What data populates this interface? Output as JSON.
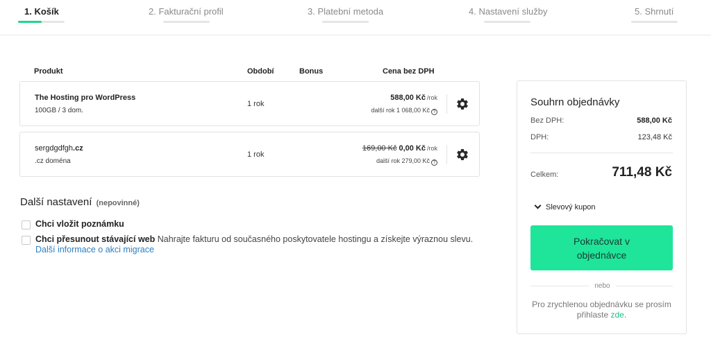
{
  "steps": [
    {
      "label": "1. Košík",
      "state": "active"
    },
    {
      "label": "2. Fakturační profil",
      "state": "pending"
    },
    {
      "label": "3. Platební metoda",
      "state": "pending"
    },
    {
      "label": "4. Nastavení služby",
      "state": "pending"
    },
    {
      "label": "5. Shrnutí",
      "state": "pending"
    }
  ],
  "table": {
    "headers": {
      "product": "Produkt",
      "period": "Období",
      "bonus": "Bonus",
      "price": "Cena bez DPH"
    },
    "rows": [
      {
        "name": "The Hosting pro WordPress",
        "sub": "100GB / 3 dom.",
        "period": "1 rok",
        "old_price": "",
        "price": "588,00 Kč",
        "per": "/rok",
        "next": "další rok 1 068,00 Kč",
        "help_icon": "question-circle-icon",
        "settings_icon": "gear-icon"
      },
      {
        "name": "sergdgdfgh",
        "tld": ".cz",
        "sub": ".cz doména",
        "period": "1 rok",
        "old_price": "169,00 Kč",
        "price": "0,00 Kč",
        "per": "/rok",
        "next": "další rok 279,00 Kč",
        "help_icon": "question-circle-icon",
        "settings_icon": "gear-icon"
      }
    ]
  },
  "extra": {
    "title": "Další nastavení",
    "optional": "(nepovinné)",
    "options": [
      {
        "label": "Chci vložit poznámku",
        "checked": false
      },
      {
        "label": "Chci přesunout stávající web",
        "description": " Nahrajte fakturu od současného poskytovatele hostingu a získejte výraznou slevu. ",
        "link": "Další informace o akci migrace",
        "checked": false
      }
    ]
  },
  "summary": {
    "title": "Souhrn objednávky",
    "net_label": "Bez DPH:",
    "net_value": "588,00 Kč",
    "vat_label": "DPH:",
    "vat_value": "123,48 Kč",
    "total_label": "Celkem:",
    "total_value": "711,48 Kč",
    "coupon_label": "Slevový kupon",
    "continue_label": "Pokračovat v objednávce",
    "or": "nebo",
    "login_text": "Pro zrychlenou objednávku se prosím přihlaste ",
    "login_link": "zde",
    "login_suffix": "."
  },
  "colors": {
    "accent": "#1fe59b",
    "link": "#2b7fc2",
    "step_active": "#1dd68e"
  }
}
